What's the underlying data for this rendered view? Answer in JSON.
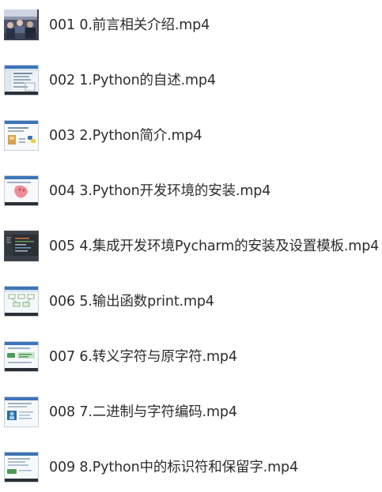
{
  "files": [
    {
      "name": "001 0.前言相关介绍.mp4",
      "thumbnail": "photo-classroom"
    },
    {
      "name": "002 1.Python的自述.mp4",
      "thumbnail": "slide-editor"
    },
    {
      "name": "003 2.Python简介.mp4",
      "thumbnail": "slide-python-logo"
    },
    {
      "name": "004 3.Python开发环境的安装.mp4",
      "thumbnail": "slide-pink-image"
    },
    {
      "name": "005 4.集成开发环境Pycharm的安装及设置模板.mp4",
      "thumbnail": "dark-ide"
    },
    {
      "name": "006 5.输出函数print.mp4",
      "thumbnail": "slide-diagram"
    },
    {
      "name": "007 6.转义字符与原字符.mp4",
      "thumbnail": "slide-green-boxes"
    },
    {
      "name": "008 7.二进制与字符编码.mp4",
      "thumbnail": "slide-blue-figure"
    },
    {
      "name": "009 8.Python中的标识符和保留字.mp4",
      "thumbnail": "slide-green-label"
    }
  ]
}
